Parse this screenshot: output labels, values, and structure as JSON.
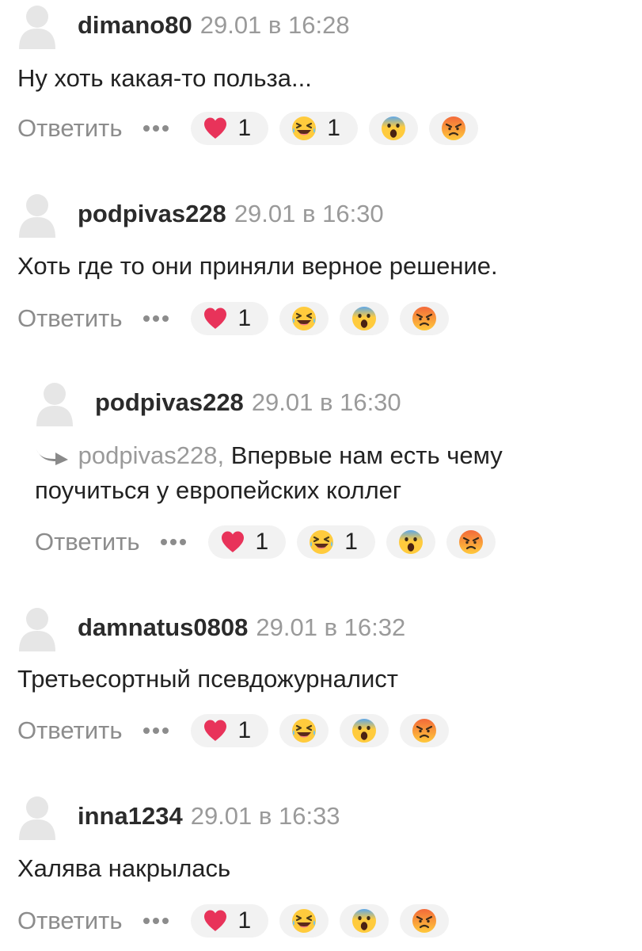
{
  "comments": [
    {
      "username": "dimano80",
      "date": "29.01 в 16:28",
      "text": "Ну хоть какая-то польза...",
      "reply_label": "Ответить",
      "reactions": {
        "heart": "1",
        "laugh": "1",
        "wow": "",
        "angry": ""
      }
    },
    {
      "username": "podpivas228",
      "date": "29.01 в 16:30",
      "text": "Хоть где то они приняли верное решение.",
      "reply_label": "Ответить",
      "reactions": {
        "heart": "1",
        "laugh": "",
        "wow": "",
        "angry": ""
      }
    },
    {
      "username": "podpivas228",
      "date": "29.01 в 16:30",
      "mention": "podpivas228,",
      "text_line1": "Впервые нам есть чему",
      "text_line2": "поучиться у европейских коллег",
      "reply_label": "Ответить",
      "reactions": {
        "heart": "1",
        "laugh": "1",
        "wow": "",
        "angry": ""
      }
    },
    {
      "username": "damnatus0808",
      "date": "29.01 в 16:32",
      "text": "Третьесортный псевдожурналист",
      "reply_label": "Ответить",
      "reactions": {
        "heart": "1",
        "laugh": "",
        "wow": "",
        "angry": ""
      }
    },
    {
      "username": "inna1234",
      "date": "29.01 в 16:33",
      "text": "Халява накрылась",
      "reply_label": "Ответить",
      "reactions": {
        "heart": "1",
        "laugh": "",
        "wow": "",
        "angry": ""
      }
    }
  ],
  "icons": {
    "avatar": "avatar-placeholder-icon",
    "more": "more-dots-icon",
    "reply_arrow": "reply-arrow-icon",
    "heart": "heart-emoji-icon",
    "laugh": "laughing-emoji-icon",
    "wow": "surprised-emoji-icon",
    "angry": "angry-emoji-icon"
  },
  "colors": {
    "username": "#2b2b2b",
    "meta": "#9a9a9a",
    "text": "#222222",
    "reaction_bg": "#f2f2f2",
    "heart": "#e8335a"
  }
}
